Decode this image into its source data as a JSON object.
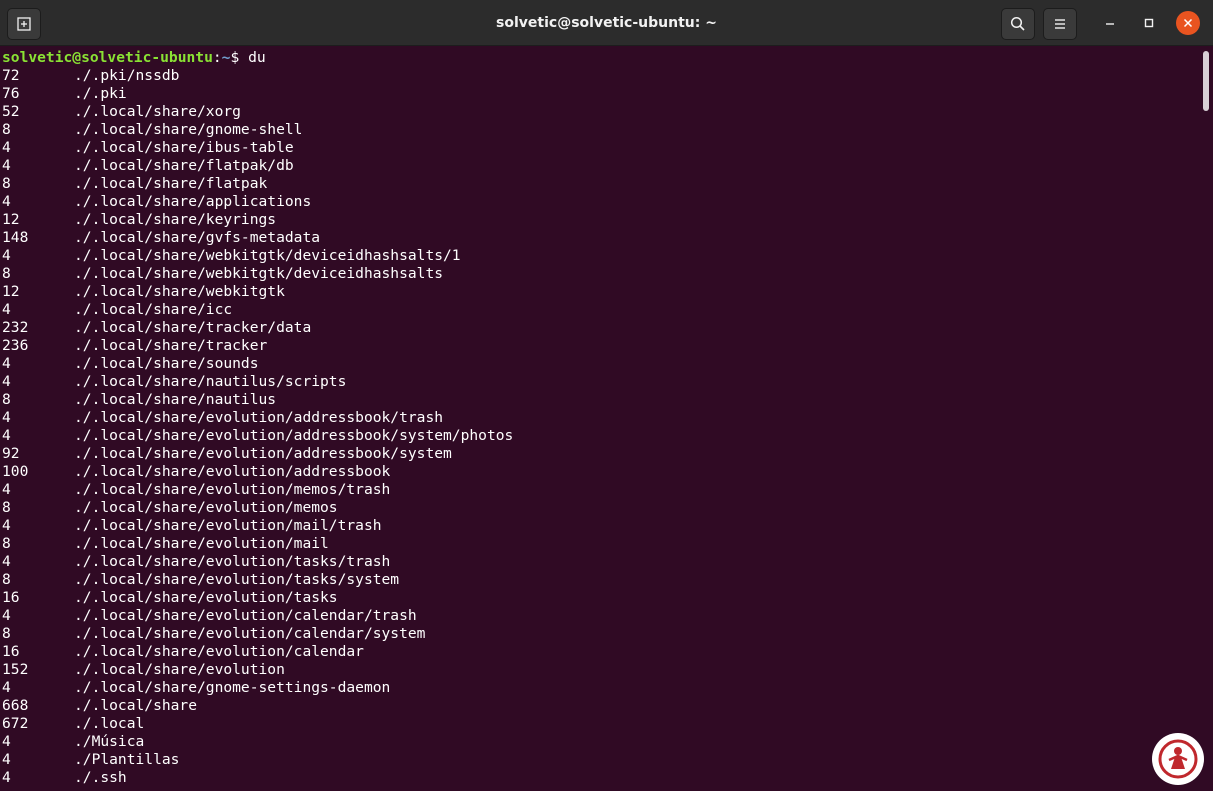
{
  "window": {
    "title": "solvetic@solvetic-ubuntu: ~"
  },
  "buttons": {
    "new_tab_icon": "new-tab-icon",
    "search_icon": "search-icon",
    "menu_icon": "hamburger-menu-icon",
    "minimize_icon": "minimize-icon",
    "maximize_icon": "maximize-icon",
    "close_icon": "close-icon"
  },
  "colors": {
    "terminal_bg": "#300a24",
    "prompt_user": "#8ae234",
    "prompt_dir": "#729fcf",
    "text": "#ffffff",
    "close_button": "#e95420",
    "titlebar": "#2c2c2c"
  },
  "prompt": {
    "user_host": "solvetic@solvetic-ubuntu",
    "separator": ":",
    "dir": "~",
    "symbol": "$",
    "command": "du"
  },
  "output": [
    {
      "size": "72",
      "path": "./.pki/nssdb"
    },
    {
      "size": "76",
      "path": "./.pki"
    },
    {
      "size": "52",
      "path": "./.local/share/xorg"
    },
    {
      "size": "8",
      "path": "./.local/share/gnome-shell"
    },
    {
      "size": "4",
      "path": "./.local/share/ibus-table"
    },
    {
      "size": "4",
      "path": "./.local/share/flatpak/db"
    },
    {
      "size": "8",
      "path": "./.local/share/flatpak"
    },
    {
      "size": "4",
      "path": "./.local/share/applications"
    },
    {
      "size": "12",
      "path": "./.local/share/keyrings"
    },
    {
      "size": "148",
      "path": "./.local/share/gvfs-metadata"
    },
    {
      "size": "4",
      "path": "./.local/share/webkitgtk/deviceidhashsalts/1"
    },
    {
      "size": "8",
      "path": "./.local/share/webkitgtk/deviceidhashsalts"
    },
    {
      "size": "12",
      "path": "./.local/share/webkitgtk"
    },
    {
      "size": "4",
      "path": "./.local/share/icc"
    },
    {
      "size": "232",
      "path": "./.local/share/tracker/data"
    },
    {
      "size": "236",
      "path": "./.local/share/tracker"
    },
    {
      "size": "4",
      "path": "./.local/share/sounds"
    },
    {
      "size": "4",
      "path": "./.local/share/nautilus/scripts"
    },
    {
      "size": "8",
      "path": "./.local/share/nautilus"
    },
    {
      "size": "4",
      "path": "./.local/share/evolution/addressbook/trash"
    },
    {
      "size": "4",
      "path": "./.local/share/evolution/addressbook/system/photos"
    },
    {
      "size": "92",
      "path": "./.local/share/evolution/addressbook/system"
    },
    {
      "size": "100",
      "path": "./.local/share/evolution/addressbook"
    },
    {
      "size": "4",
      "path": "./.local/share/evolution/memos/trash"
    },
    {
      "size": "8",
      "path": "./.local/share/evolution/memos"
    },
    {
      "size": "4",
      "path": "./.local/share/evolution/mail/trash"
    },
    {
      "size": "8",
      "path": "./.local/share/evolution/mail"
    },
    {
      "size": "4",
      "path": "./.local/share/evolution/tasks/trash"
    },
    {
      "size": "8",
      "path": "./.local/share/evolution/tasks/system"
    },
    {
      "size": "16",
      "path": "./.local/share/evolution/tasks"
    },
    {
      "size": "4",
      "path": "./.local/share/evolution/calendar/trash"
    },
    {
      "size": "8",
      "path": "./.local/share/evolution/calendar/system"
    },
    {
      "size": "16",
      "path": "./.local/share/evolution/calendar"
    },
    {
      "size": "152",
      "path": "./.local/share/evolution"
    },
    {
      "size": "4",
      "path": "./.local/share/gnome-settings-daemon"
    },
    {
      "size": "668",
      "path": "./.local/share"
    },
    {
      "size": "672",
      "path": "./.local"
    },
    {
      "size": "4",
      "path": "./Música"
    },
    {
      "size": "4",
      "path": "./Plantillas"
    },
    {
      "size": "4",
      "path": "./.ssh"
    }
  ]
}
